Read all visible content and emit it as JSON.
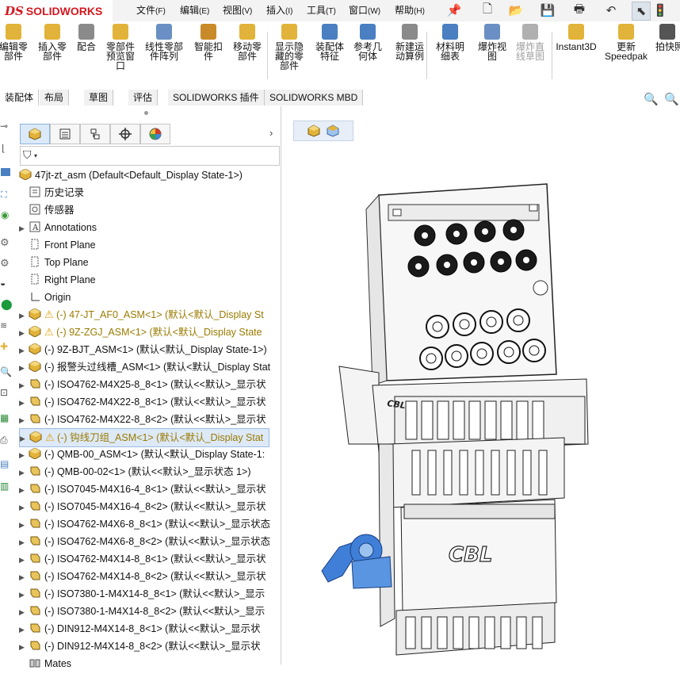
{
  "app": {
    "logo_prefix": "DS",
    "logo_text": "SOLIDWORKS"
  },
  "menu": [
    {
      "label": "文件",
      "key": "(F)"
    },
    {
      "label": "编辑",
      "key": "(E)"
    },
    {
      "label": "视图",
      "key": "(V)"
    },
    {
      "label": "插入",
      "key": "(I)"
    },
    {
      "label": "工具",
      "key": "(T)"
    },
    {
      "label": "窗口",
      "key": "(W)"
    },
    {
      "label": "帮助",
      "key": "(H)"
    }
  ],
  "ribbon": [
    {
      "label": "编辑零\n部件",
      "icon": "edit-component-icon",
      "color": "#e2b33a"
    },
    {
      "label": "插入零\n部件",
      "icon": "insert-component-icon",
      "color": "#e2b33a"
    },
    {
      "label": "配合",
      "icon": "mate-icon",
      "color": "#8a8a8a"
    },
    {
      "label": "零部件\n预览窗\n口",
      "icon": "preview-window-icon",
      "color": "#e2b33a"
    },
    {
      "label": "线性零部\n件阵列",
      "icon": "linear-pattern-icon",
      "color": "#6a8fc4"
    },
    {
      "label": "智能扣\n件",
      "icon": "smart-fastener-icon",
      "color": "#c98a2a"
    },
    {
      "label": "移动零\n部件",
      "icon": "move-component-icon",
      "color": "#e2b33a"
    },
    {
      "label": "显示隐\n藏的零\n部件",
      "icon": "show-hidden-icon",
      "color": "#e2b33a"
    },
    {
      "label": "装配体\n特征",
      "icon": "assembly-feature-icon",
      "color": "#4a7fc1"
    },
    {
      "label": "参考几\n何体",
      "icon": "reference-geometry-icon",
      "color": "#4a7fc1"
    },
    {
      "label": "新建运\n动算例",
      "icon": "motion-study-icon",
      "color": "#8a8a8a"
    },
    {
      "label": "材料明\n细表",
      "icon": "bom-icon",
      "color": "#4a7fc1"
    },
    {
      "label": "爆炸视\n图",
      "icon": "explode-view-icon",
      "color": "#6a8fc4"
    },
    {
      "label": "爆炸直\n线草图",
      "icon": "explode-line-icon",
      "color": "#b0b0b0",
      "disabled": true
    },
    {
      "label": "Instant3D",
      "icon": "instant3d-icon",
      "color": "#e2b33a"
    },
    {
      "label": "更新\nSpeedpak",
      "icon": "speedpak-icon",
      "color": "#e2b33a"
    },
    {
      "label": "拍快照",
      "icon": "snapshot-icon",
      "color": "#555555"
    }
  ],
  "tabs": [
    "装配体",
    "布局",
    "草图",
    "评估",
    "SOLIDWORKS 插件",
    "SOLIDWORKS MBD"
  ],
  "tree": {
    "root": "47jt-zt_asm  (Default<Default_Display State-1>)",
    "items": [
      {
        "text": "历史记录",
        "icon": "history-icon",
        "expand": false
      },
      {
        "text": "传感器",
        "icon": "sensor-icon",
        "expand": false
      },
      {
        "text": "Annotations",
        "icon": "annotations-icon",
        "expand": true
      },
      {
        "text": "Front Plane",
        "icon": "plane-icon",
        "expand": false
      },
      {
        "text": "Top Plane",
        "icon": "plane-icon",
        "expand": false
      },
      {
        "text": "Right Plane",
        "icon": "plane-icon",
        "expand": false
      },
      {
        "text": "Origin",
        "icon": "origin-icon",
        "expand": false
      },
      {
        "text": "(-) 47-JT_AF0_ASM<1> (默认<默认_Display St",
        "icon": "assembly-icon",
        "expand": true,
        "warn": true
      },
      {
        "text": "(-) 9Z-ZGJ_ASM<1> (默认<默认_Display State",
        "icon": "assembly-icon",
        "expand": true,
        "warn": true
      },
      {
        "text": "(-) 9Z-BJT_ASM<1> (默认<默认_Display State-1>)",
        "icon": "assembly-icon",
        "expand": true
      },
      {
        "text": "(-) 报警头过线槽_ASM<1> (默认<默认_Display Stat",
        "icon": "assembly-icon",
        "expand": true
      },
      {
        "text": "(-) ISO4762-M4X25-8_8<1> (默认<<默认>_显示状",
        "icon": "part-icon",
        "expand": true
      },
      {
        "text": "(-) ISO4762-M4X22-8_8<1> (默认<<默认>_显示状",
        "icon": "part-icon",
        "expand": true
      },
      {
        "text": "(-) ISO4762-M4X22-8_8<2> (默认<<默认>_显示状",
        "icon": "part-icon",
        "expand": true
      },
      {
        "text": "(-) 钩线刀组_ASM<1> (默认<默认_Display Stat",
        "icon": "assembly-icon",
        "expand": true,
        "warn": true,
        "selected": true
      },
      {
        "text": "(-) QMB-00_ASM<1> (默认<默认_Display State-1:",
        "icon": "assembly-icon",
        "expand": true
      },
      {
        "text": "(-) QMB-00-02<1> (默认<<默认>_显示状态 1>)",
        "icon": "part-icon",
        "expand": true
      },
      {
        "text": "(-) ISO7045-M4X16-4_8<1> (默认<<默认>_显示状",
        "icon": "part-icon",
        "expand": true
      },
      {
        "text": "(-) ISO7045-M4X16-4_8<2> (默认<<默认>_显示状",
        "icon": "part-icon",
        "expand": true
      },
      {
        "text": "(-) ISO4762-M4X6-8_8<1> (默认<<默认>_显示状态",
        "icon": "part-icon",
        "expand": true
      },
      {
        "text": "(-) ISO4762-M4X6-8_8<2> (默认<<默认>_显示状态",
        "icon": "part-icon",
        "expand": true
      },
      {
        "text": "(-) ISO4762-M4X14-8_8<1> (默认<<默认>_显示状",
        "icon": "part-icon",
        "expand": true
      },
      {
        "text": "(-) ISO4762-M4X14-8_8<2> (默认<<默认>_显示状",
        "icon": "part-icon",
        "expand": true
      },
      {
        "text": "(-) ISO7380-1-M4X14-8_8<1> (默认<<默认>_显示",
        "icon": "part-icon",
        "expand": true
      },
      {
        "text": "(-) ISO7380-1-M4X14-8_8<2> (默认<<默认>_显示",
        "icon": "part-icon",
        "expand": true
      },
      {
        "text": "(-) DIN912-M4X14-8_8<1> (默认<<默认>_显示状",
        "icon": "part-icon",
        "expand": true
      },
      {
        "text": "(-) DIN912-M4X14-8_8<2> (默认<<默认>_显示状",
        "icon": "part-icon",
        "expand": true
      },
      {
        "text": "Mates",
        "icon": "mates-icon",
        "expand": false
      }
    ]
  },
  "model": {
    "brand_top": "CBL",
    "brand_main": "CBL"
  },
  "colors": {
    "brand_red": "#d41820",
    "selection": "#dde9f7",
    "warning": "#e0a000",
    "accent_blue": "#4a7fc1"
  }
}
